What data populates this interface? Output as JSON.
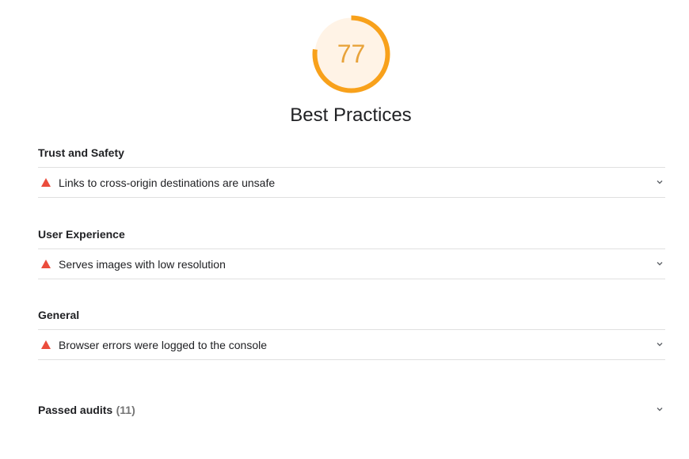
{
  "score": {
    "value": "77",
    "fraction": 0.77,
    "color": "#f8a11b",
    "background": "#fff3e6"
  },
  "category": {
    "title": "Best Practices"
  },
  "groups": [
    {
      "title": "Trust and Safety",
      "audits": [
        {
          "title": "Links to cross-origin destinations are unsafe",
          "status": "fail",
          "icon": "red-triangle-icon"
        }
      ]
    },
    {
      "title": "User Experience",
      "audits": [
        {
          "title": "Serves images with low resolution",
          "status": "fail",
          "icon": "red-triangle-icon"
        }
      ]
    },
    {
      "title": "General",
      "audits": [
        {
          "title": "Browser errors were logged to the console",
          "status": "fail",
          "icon": "red-triangle-icon"
        }
      ]
    }
  ],
  "passed": {
    "label": "Passed audits",
    "count": "(11)"
  },
  "colors": {
    "fail": "#eb4c3c",
    "divider": "#e0e0e0"
  }
}
